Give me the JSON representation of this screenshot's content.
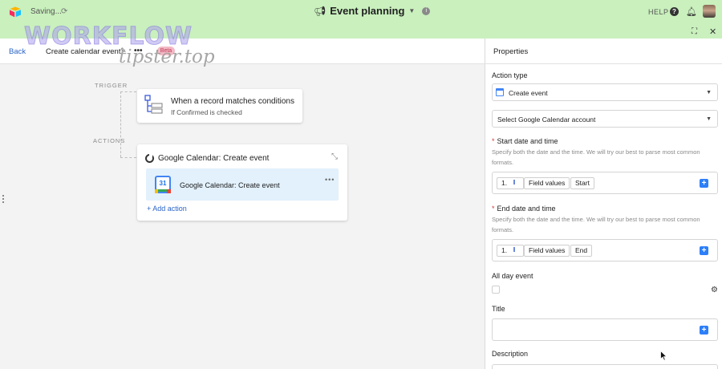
{
  "topbar": {
    "saving_text": "Saving...",
    "base_title": "Event planning",
    "help_label": "HELP"
  },
  "breadcrumb": {
    "back_label": "Back",
    "workflow_name": "Create calendar event",
    "more_label": "•••",
    "badge_label": "Beta"
  },
  "watermark": {
    "line1": "WORKFLOW",
    "line2": "tipster.top"
  },
  "canvas": {
    "trigger_label": "TRIGGER",
    "actions_label": "ACTIONS",
    "trigger_card": {
      "title": "When a record matches conditions",
      "subtitle": "If Confirmed is checked"
    },
    "action_card": {
      "title": "Google Calendar: Create event",
      "row_label": "Google Calendar: Create event",
      "row_more": "•••",
      "calendar_day": "31",
      "add_action_label": "+ Add action"
    }
  },
  "properties": {
    "panel_title": "Properties",
    "action_type_label": "Action type",
    "action_type_value": "Create event",
    "account_placeholder": "Select Google Calendar account",
    "start": {
      "label": "Start date and time",
      "help": "Specify both the date and the time. We will try our best to parse most common formats.",
      "step": "1.",
      "token1": "Field values",
      "token2": "Start"
    },
    "end": {
      "label": "End date and time",
      "help": "Specify both the date and the time. We will try our best to parse most common formats.",
      "step": "1.",
      "token1": "Field values",
      "token2": "End"
    },
    "all_day_label": "All day event",
    "title_label": "Title",
    "description_label": "Description",
    "plus_symbol": "+"
  },
  "colors": {
    "topbar_bg": "#c9f0bd",
    "link_blue": "#2b64c8",
    "plus_blue": "#2d7ff9",
    "highlight_row": "#e2f1fc",
    "required_red": "#d23a3a"
  },
  "icons": {
    "logo": "airtable-logo-icon",
    "spinner": "sync-spinner-icon",
    "title": "megaphone-icon",
    "info": "info-icon",
    "help": "question-icon",
    "bell": "bell-icon",
    "focus": "focus-icon",
    "close": "close-icon"
  }
}
